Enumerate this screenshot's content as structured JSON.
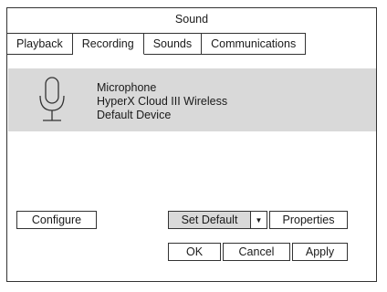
{
  "window": {
    "title": "Sound"
  },
  "tabs": [
    {
      "label": "Playback"
    },
    {
      "label": "Recording",
      "active": true
    },
    {
      "label": "Sounds"
    },
    {
      "label": "Communications"
    }
  ],
  "device": {
    "icon": "microphone-icon",
    "name": "Microphone",
    "description": "HyperX Cloud III Wireless",
    "status": "Default Device"
  },
  "buttons": {
    "configure": "Configure",
    "set_default": "Set Default",
    "set_default_arrow": "▼",
    "properties": "Properties",
    "ok": "OK",
    "cancel": "Cancel",
    "apply": "Apply"
  },
  "colors": {
    "selected_row": "#d9d9d9",
    "border": "#333333"
  }
}
